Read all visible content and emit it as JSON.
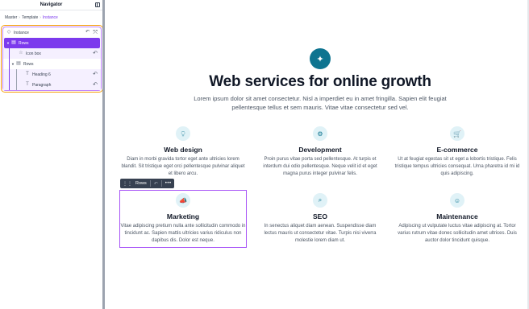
{
  "navigator": {
    "title": "Navigator",
    "breadcrumb": [
      "Master",
      "Template",
      "Instance"
    ],
    "tree": {
      "instance": "Instance",
      "rows_selected": "Rows",
      "icon_box": "Icon box",
      "rows": "Rows",
      "heading": "Heading 6",
      "paragraph": "Paragraph"
    }
  },
  "hero": {
    "title": "Web services for online growth",
    "subtitle": "Lorem ipsum dolor sit amet consectetur. Nisl a imperdiet eu in amet fringilla. Sapien elit feugiat pellentesque tellus et sem mauris. Vitae vitae consectetur sed vel."
  },
  "toolbar": {
    "label": "Rows"
  },
  "cards": [
    {
      "icon": "pen-tool-icon",
      "glyph": "⍜",
      "title": "Web design",
      "desc": "Diam in morbi gravida tortor eget ante ultricies lorem blandit. Sit tristique eget orci pellentesque pulvinar aliquet et libero arcu."
    },
    {
      "icon": "settings-icon",
      "glyph": "⚙",
      "title": "Development",
      "desc": "Proin purus vitae porta sed pellentesque. At turpis et interdum dui odio pellentesque. Neque velit id et eget magna purus integer pulvinar felis."
    },
    {
      "icon": "cart-icon",
      "glyph": "🛒",
      "title": "E-commerce",
      "desc": "Ut at feugiat egestas sit ut eget a lobortis tristique. Felis tristique tempus ultricies consequat. Urna pharetra id mi id quis adipiscing."
    },
    {
      "icon": "megaphone-icon",
      "glyph": "📣",
      "title": "Marketing",
      "desc": "Vitae adipiscing pretium nulla ante sollicitudin commodo in tincidunt ac. Sapien mattis ultricies varius ridiculus non dapibus dis. Dolor est neque."
    },
    {
      "icon": "search-icon",
      "glyph": "⌕",
      "title": "SEO",
      "desc": "In senectus aliquet diam aenean. Suspendisse diam lectus mauris ut consectetur vitae. Turpis nisi viverra molestie lorem diam ut."
    },
    {
      "icon": "support-icon",
      "glyph": "☺",
      "title": "Maintenance",
      "desc": "Adipiscing ut vulputate luctus vitae adipiscing at. Tortor varius rutrum vitae donec sollicitudin amet ultrices. Duis auctor dolor tincidunt quisque."
    }
  ],
  "colors": {
    "accent": "#7c3aed",
    "brand": "#0e7490",
    "outline": "#f59e0b"
  }
}
